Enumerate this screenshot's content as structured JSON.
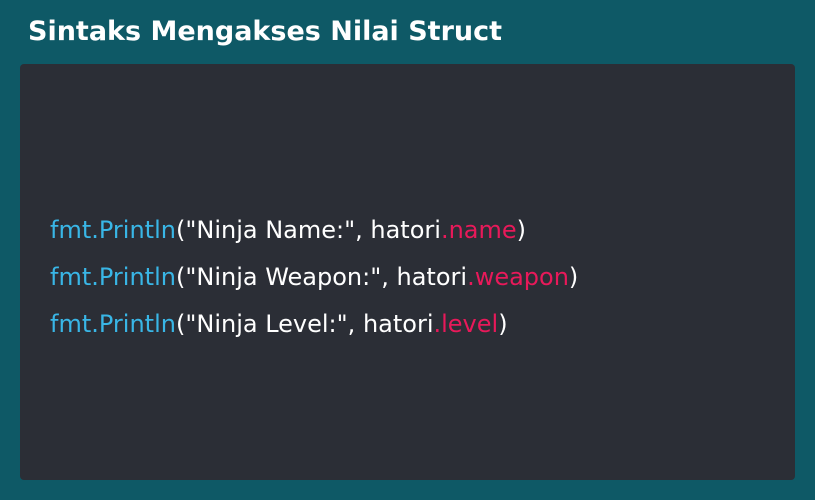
{
  "header": {
    "title": "Sintaks Mengakses Nilai Struct"
  },
  "code": {
    "lines": [
      {
        "call": "fmt.Println",
        "open": "(",
        "args": "\"Ninja Name:\", hatori",
        "field": ".name",
        "close": ")"
      },
      {
        "call": "fmt.Println",
        "open": "(",
        "args": "\"Ninja Weapon:\", hatori",
        "field": ".weapon",
        "close": ")"
      },
      {
        "call": "fmt.Println",
        "open": "(",
        "args": "\"Ninja Level:\", hatori",
        "field": ".level",
        "close": ")"
      }
    ]
  },
  "colors": {
    "background": "#0e5966",
    "panel": "#2b2e36",
    "function": "#39b6e6",
    "field": "#e8195a",
    "text": "#ffffff"
  }
}
